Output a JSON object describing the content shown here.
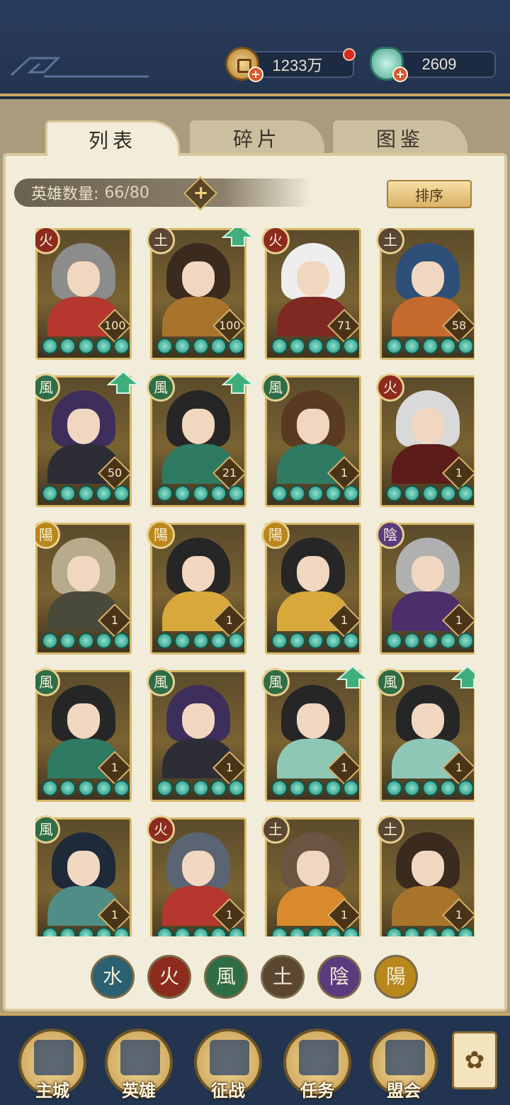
{
  "resources": {
    "coins": "1233万",
    "shells": "2609",
    "coin_icon": "copper-coin-icon",
    "shell_icon": "jade-shell-icon"
  },
  "tabs": [
    {
      "label": "列表",
      "active": true
    },
    {
      "label": "碎片",
      "active": false
    },
    {
      "label": "图鉴",
      "active": false
    }
  ],
  "hero_count": {
    "label": "英雄数量:",
    "value": "66/80"
  },
  "sort_label": "排序",
  "elements": {
    "fire": "火",
    "earth": "土",
    "wind": "風",
    "yang": "陽",
    "yin": "陰",
    "water": "水"
  },
  "heroes": [
    {
      "element": "火",
      "level": "100",
      "upgrade": false,
      "hair": "#8c8c8c",
      "body": "#b5372d"
    },
    {
      "element": "土",
      "level": "100",
      "upgrade": true,
      "hair": "#3b2a1e",
      "body": "#a8742c"
    },
    {
      "element": "火",
      "level": "71",
      "upgrade": false,
      "hair": "#eeeeee",
      "body": "#7e2a23"
    },
    {
      "element": "土",
      "level": "58",
      "upgrade": false,
      "hair": "#2e4f77",
      "body": "#c56a2d"
    },
    {
      "element": "風",
      "level": "50",
      "upgrade": true,
      "hair": "#3d2e5c",
      "body": "#2d2d35"
    },
    {
      "element": "風",
      "level": "21",
      "upgrade": true,
      "hair": "#262626",
      "body": "#2f7a62"
    },
    {
      "element": "風",
      "level": "1",
      "upgrade": false,
      "hair": "#5a3b22",
      "body": "#2f7a62"
    },
    {
      "element": "火",
      "level": "1",
      "upgrade": false,
      "hair": "#d9d9d9",
      "body": "#5c1d1a"
    },
    {
      "element": "陽",
      "level": "1",
      "upgrade": false,
      "hair": "#b7ab8c",
      "body": "#4a4a3a"
    },
    {
      "element": "陽",
      "level": "1",
      "upgrade": false,
      "hair": "#262626",
      "body": "#d8a93a"
    },
    {
      "element": "陽",
      "level": "1",
      "upgrade": false,
      "hair": "#262626",
      "body": "#d8a93a"
    },
    {
      "element": "陰",
      "level": "1",
      "upgrade": false,
      "hair": "#b0b0b0",
      "body": "#4e2d6b"
    },
    {
      "element": "風",
      "level": "1",
      "upgrade": false,
      "hair": "#262626",
      "body": "#2f7a62"
    },
    {
      "element": "風",
      "level": "1",
      "upgrade": false,
      "hair": "#3d2e5c",
      "body": "#2d2d35"
    },
    {
      "element": "風",
      "level": "1",
      "upgrade": true,
      "hair": "#262626",
      "body": "#8fc7b6"
    },
    {
      "element": "風",
      "level": "1",
      "upgrade": true,
      "hair": "#262626",
      "body": "#8fc7b6"
    },
    {
      "element": "風",
      "level": "1",
      "upgrade": false,
      "hair": "#1e2a3a",
      "body": "#4f8d86"
    },
    {
      "element": "火",
      "level": "1",
      "upgrade": false,
      "hair": "#5a6472",
      "body": "#b5372d"
    },
    {
      "element": "土",
      "level": "1",
      "upgrade": false,
      "hair": "#6a5442",
      "body": "#d98a2d"
    },
    {
      "element": "土",
      "level": "1",
      "upgrade": false,
      "hair": "#3b2a1e",
      "body": "#a8742c"
    }
  ],
  "element_filters": [
    "水",
    "火",
    "風",
    "土",
    "陰",
    "陽"
  ],
  "filter_colors": [
    "#2b5f72",
    "#8c2b1e",
    "#2f6d46",
    "#5a4631",
    "#5b3a7e",
    "#b9871c"
  ],
  "nav": [
    {
      "label": "主城",
      "icon": "city-gate-icon"
    },
    {
      "label": "英雄",
      "icon": "hero-portrait-icon"
    },
    {
      "label": "征战",
      "icon": "battle-icon"
    },
    {
      "label": "任务",
      "icon": "task-scroll-icon"
    },
    {
      "label": "盟会",
      "icon": "guild-pavilion-icon"
    }
  ],
  "menu_icon": "menu-knot-icon"
}
